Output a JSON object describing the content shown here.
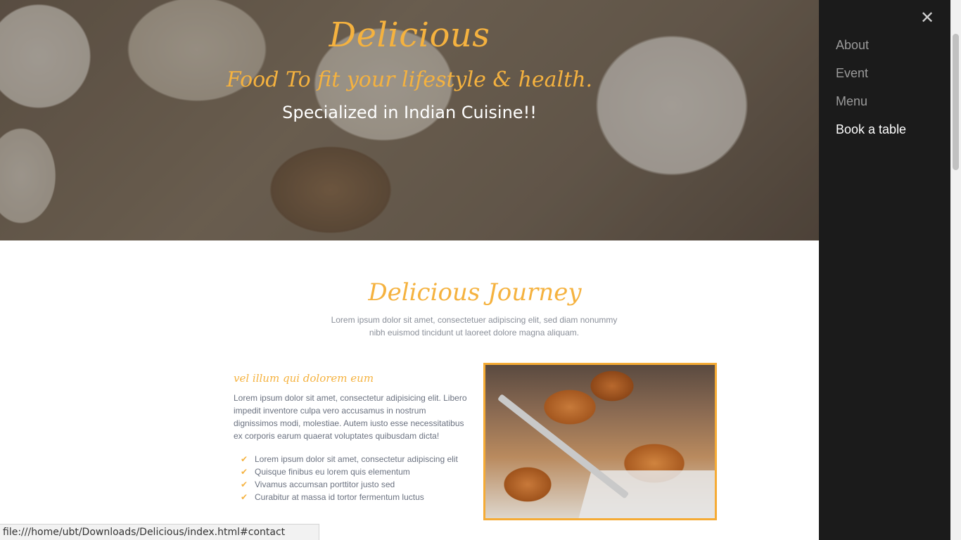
{
  "hero": {
    "brand": "Delicious",
    "tagline": "Food To fit your lifestyle & health.",
    "subtitle": "Specialized in Indian Cuisine!!"
  },
  "section": {
    "title": "Delicious Journey",
    "intro": "Lorem ipsum dolor sit amet, consectetuer adipiscing elit, sed diam nonummy nibh euismod tincidunt ut laoreet dolore magna aliquam.",
    "feature_title": "vel illum qui dolorem eum",
    "feature_body": "Lorem ipsum dolor sit amet, consectetur adipisicing elit. Libero impedit inventore culpa vero accusamus in nostrum dignissimos modi, molestiae. Autem iusto esse necessitatibus ex corporis earum quaerat voluptates quibusdam dicta!",
    "feature_list": [
      "Lorem ipsum dolor sit amet, consectetur adipiscing elit",
      "Quisque finibus eu lorem quis elementum",
      "Vivamus accumsan porttitor justo sed",
      "Curabitur at massa id tortor fermentum luctus"
    ]
  },
  "sidebar": {
    "close_icon": "close-icon",
    "items": [
      {
        "label": "About"
      },
      {
        "label": "Event"
      },
      {
        "label": "Menu"
      },
      {
        "label": "Book a table"
      }
    ]
  },
  "status_bar": {
    "url": "file:///home/ubt/Downloads/Delicious/index.html#contact"
  },
  "colors": {
    "accent": "#f5b23f",
    "sidebar_bg": "#1b1b1b",
    "nav_inactive": "#9b9b9b",
    "nav_active": "#ffffff",
    "body_text": "#6b7280"
  }
}
